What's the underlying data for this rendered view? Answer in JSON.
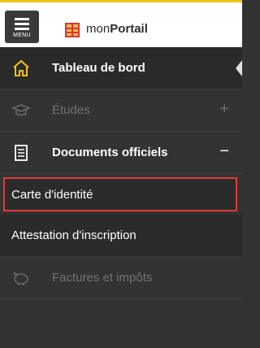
{
  "header": {
    "menu_label": "MENU",
    "app_name_prefix": "mon",
    "app_name_bold": "Portail",
    "accent_color": "#f1c40f",
    "logo_color": "#d8343a"
  },
  "menu": {
    "items": [
      {
        "label": "Tableau de bord",
        "icon": "home-icon"
      },
      {
        "label": "Études",
        "icon": "graduation-cap-icon",
        "sign": "+"
      },
      {
        "label": "Documents officiels",
        "icon": "document-icon",
        "sign": "−"
      },
      {
        "label": "Factures et impôts",
        "icon": "piggy-bank-icon"
      }
    ],
    "sub_items": [
      {
        "label": "Carte d'identité"
      },
      {
        "label": "Attestation d'inscription"
      }
    ],
    "highlight_color": "#e23b3b"
  }
}
